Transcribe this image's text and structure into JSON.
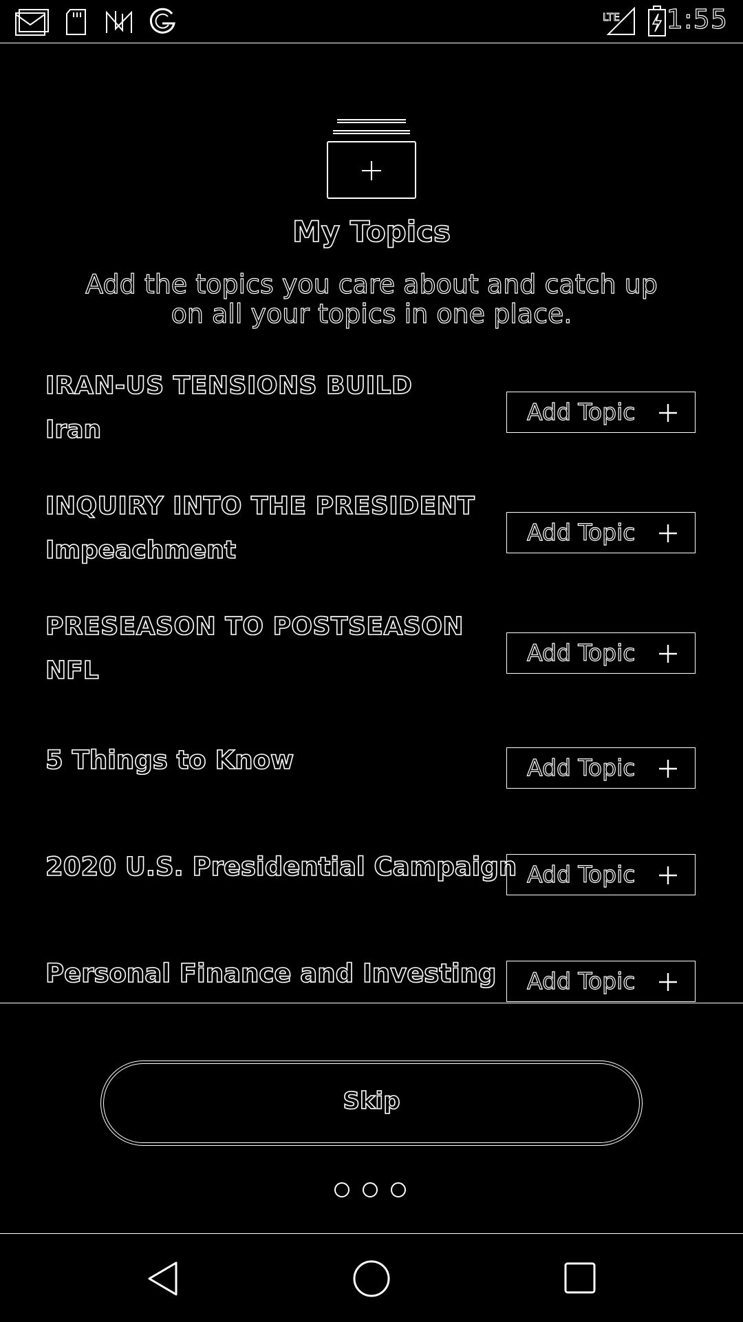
{
  "status_bar": {
    "time": "1:55",
    "left_icons": [
      "gmail-icon",
      "sd-card-icon",
      "nfc-icon",
      "google-icon"
    ],
    "right_icons": [
      "lte-signal-icon",
      "battery-charging-icon"
    ],
    "network_label": "LTE"
  },
  "header": {
    "icon": "add-topic-stack-icon",
    "title": "My Topics",
    "subtitle_line1": "Add the topics you care about and catch up",
    "subtitle_line2": "on all your topics in one place."
  },
  "topics": [
    {
      "kicker": "IRAN-US TENSIONS BUILD",
      "name": "Iran",
      "button": "Add Topic"
    },
    {
      "kicker": "INQUIRY INTO THE PRESIDENT",
      "name": "Impeachment",
      "button": "Add Topic"
    },
    {
      "kicker": "PRESEASON TO POSTSEASON",
      "name": "NFL",
      "button": "Add Topic"
    },
    {
      "name": "5 Things to Know",
      "button": "Add Topic"
    },
    {
      "name": "2020 U.S. Presidential Campaign",
      "button": "Add Topic"
    },
    {
      "name": "Personal Finance and Investing",
      "button": "Add Topic"
    }
  ],
  "skip_label": "Skip",
  "pager": {
    "count": 3,
    "active": 0
  },
  "nav": [
    "back-icon",
    "home-icon",
    "recents-icon"
  ]
}
